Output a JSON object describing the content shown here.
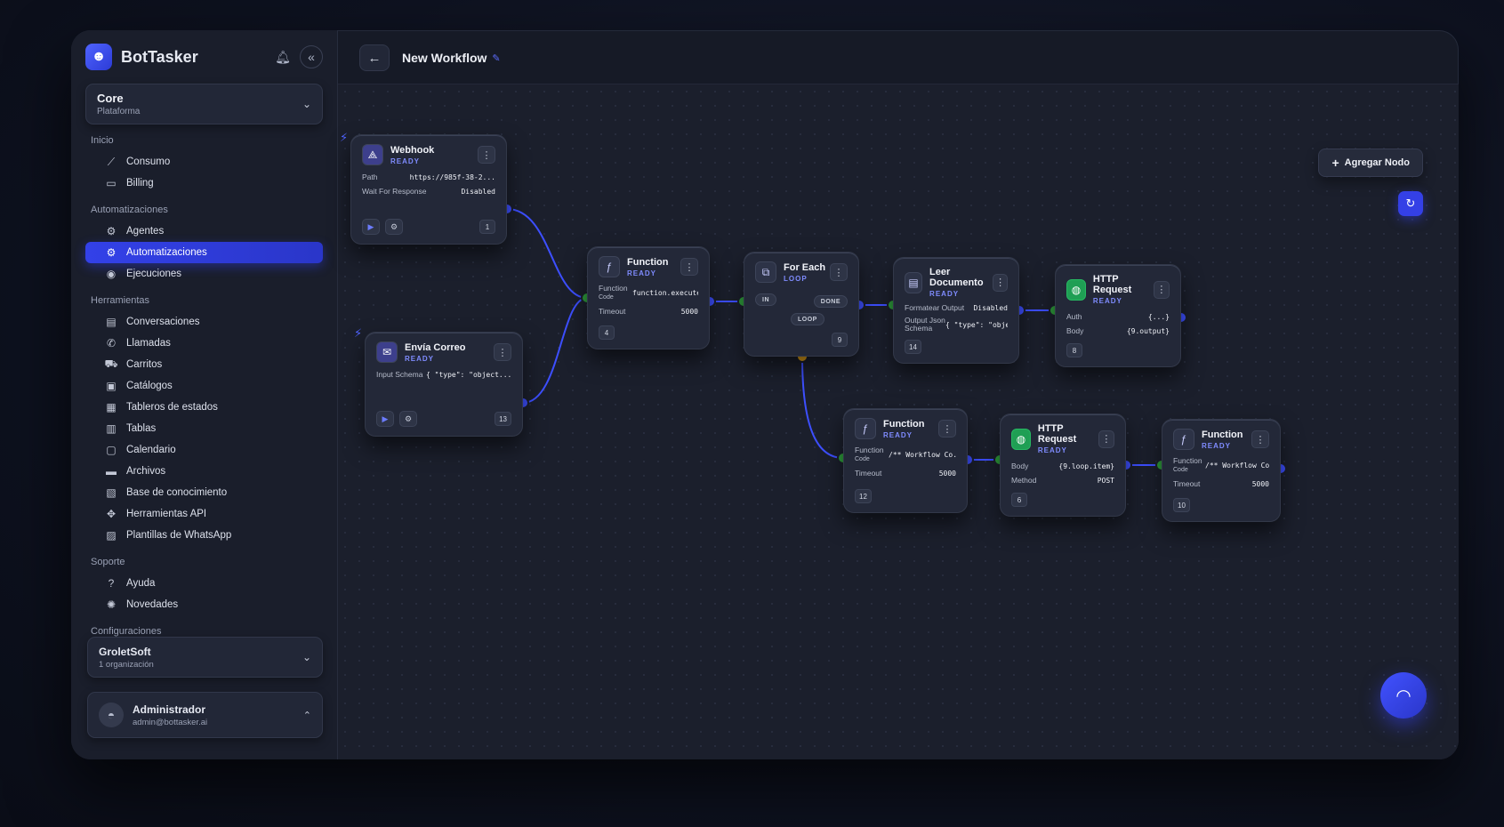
{
  "brand": {
    "name": "BotTasker"
  },
  "workspace": {
    "name": "Core",
    "subtitle": "Plataforma"
  },
  "nav": {
    "inicio": "Inicio",
    "consumo": "Consumo",
    "billing": "Billing",
    "automatizaciones_section": "Automatizaciones",
    "agentes": "Agentes",
    "automatizaciones": "Automatizaciones",
    "ejecuciones": "Ejecuciones",
    "herramientas_section": "Herramientas",
    "herramientas": [
      {
        "label": "Conversaciones",
        "icon": "chat-icon",
        "glyph": "▤"
      },
      {
        "label": "Llamadas",
        "icon": "phone-icon",
        "glyph": "✆"
      },
      {
        "label": "Carritos",
        "icon": "cart-icon",
        "glyph": "⛟"
      },
      {
        "label": "Catálogos",
        "icon": "catalog-icon",
        "glyph": "▣"
      },
      {
        "label": "Tableros de estados",
        "icon": "board-icon",
        "glyph": "▦"
      },
      {
        "label": "Tablas",
        "icon": "table-icon",
        "glyph": "▥"
      },
      {
        "label": "Calendario",
        "icon": "calendar-icon",
        "glyph": "▢"
      },
      {
        "label": "Archivos",
        "icon": "folder-icon",
        "glyph": "▬"
      },
      {
        "label": "Base de conocimiento",
        "icon": "book-icon",
        "glyph": "▧"
      },
      {
        "label": "Herramientas API",
        "icon": "api-icon",
        "glyph": "✥"
      },
      {
        "label": "Plantillas de WhatsApp",
        "icon": "template-icon",
        "glyph": "▨"
      }
    ],
    "soporte_section": "Soporte",
    "ayuda": "Ayuda",
    "novedades": "Novedades",
    "config_section": "Configuraciones"
  },
  "org": {
    "name": "GroletSoft",
    "subtitle": "1 organización"
  },
  "user": {
    "name": "Administrador",
    "email": "admin@bottasker.ai"
  },
  "workflow": {
    "title": "New Workflow",
    "add_node": "Agregar Nodo"
  },
  "colors": {
    "accent": "#3341e8",
    "edge": "#3d4fff",
    "port_in": "#2f9e3c",
    "port_loop": "#e3a21a"
  },
  "nodes": {
    "webhook": {
      "title": "Webhook",
      "status": "READY",
      "k1": "Path",
      "v1": "https://985f-38-2...",
      "k2": "Wait For Response",
      "v2": "Disabled",
      "id": "1"
    },
    "envia": {
      "title": "Envía Correo",
      "status": "READY",
      "k1": "Input Schema",
      "v1": "{ \"type\": \"object...",
      "id": "13"
    },
    "function4": {
      "title": "Function",
      "status": "READY",
      "k1": "Function",
      "k1b": "Code",
      "v1": "function.execute(...",
      "k2": "Timeout",
      "v2": "5000",
      "id": "4"
    },
    "foreach": {
      "title": "For Each",
      "status": "LOOP",
      "in": "IN",
      "done": "DONE",
      "loop": "LOOP",
      "id": "9"
    },
    "leer": {
      "title": "Leer Documento",
      "status": "READY",
      "k1": "Formatear Output",
      "v1": "Disabled",
      "k2": "Output Json Schema",
      "v2": "{ \"type\": \"object...",
      "id": "14"
    },
    "http8": {
      "title": "HTTP Request",
      "status": "READY",
      "k1": "Auth",
      "v1": "{...}",
      "k2": "Body",
      "v2": "{9.output}",
      "id": "8"
    },
    "function12": {
      "title": "Function",
      "status": "READY",
      "k1": "Function",
      "k1b": "Code",
      "v1": "/** Workflow Co...",
      "k2": "Timeout",
      "v2": "5000",
      "id": "12"
    },
    "http6": {
      "title": "HTTP Request",
      "status": "READY",
      "k1": "Body",
      "v1": "{9.loop.item}",
      "k2": "Method",
      "v2": "POST",
      "id": "6"
    },
    "function10": {
      "title": "Function",
      "status": "READY",
      "k1": "Function",
      "k1b": "Code",
      "v1": "/** Workflow Co...",
      "k2": "Timeout",
      "v2": "5000",
      "id": "10"
    }
  }
}
